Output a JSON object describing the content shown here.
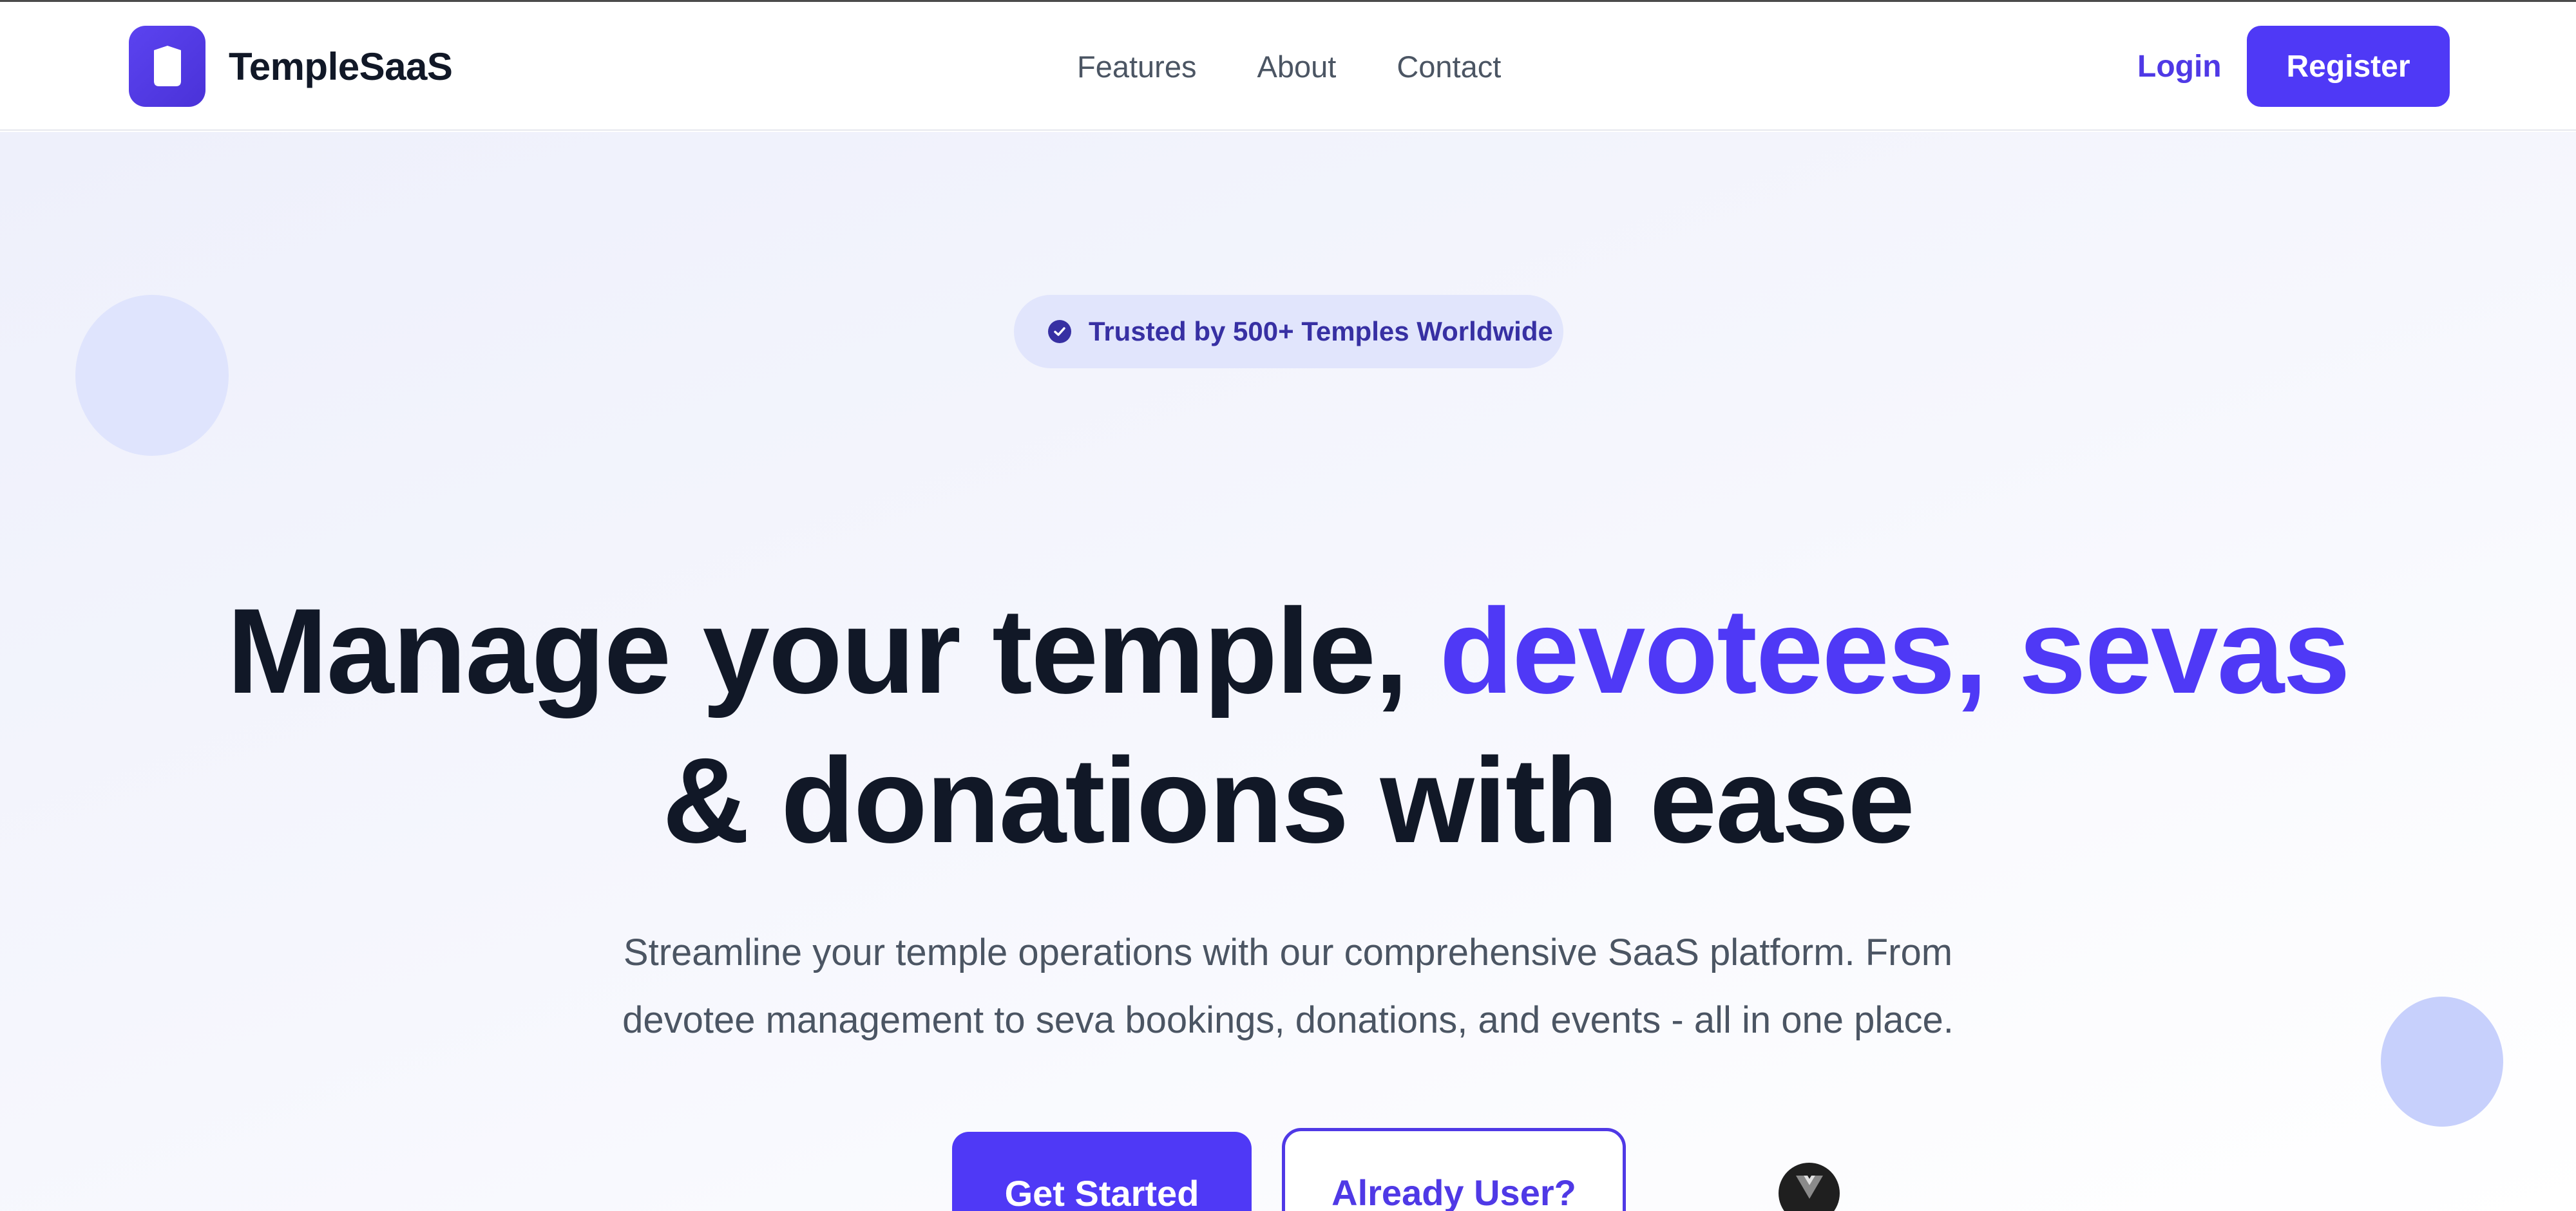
{
  "brand": {
    "name": "TempleSaaS",
    "logo_icon": "shield-icon"
  },
  "nav": {
    "links": [
      {
        "label": "Features"
      },
      {
        "label": "About"
      },
      {
        "label": "Contact"
      }
    ],
    "login_label": "Login",
    "register_label": "Register"
  },
  "hero": {
    "badge_text": "Trusted by 500+ Temples Worldwide",
    "badge_icon": "check-circle-icon",
    "headline_part1": "Manage your temple, ",
    "headline_accent": "devotees, sevas",
    "headline_part2": "& donations with ease",
    "subtext_line1": "Streamline your temple operations with our comprehensive SaaS platform. From",
    "subtext_line2": "devotee management to seva bookings, donations, and events - all in one place.",
    "primary_cta": "Get Started",
    "secondary_cta": "Already User?"
  },
  "floating_badge": {
    "icon": "vue-logo-icon"
  },
  "colors": {
    "accent": "#4f39f6",
    "heading": "#111827",
    "body_text": "#4b5563",
    "badge_bg": "#e1e5fc",
    "badge_text": "#3730a3"
  }
}
